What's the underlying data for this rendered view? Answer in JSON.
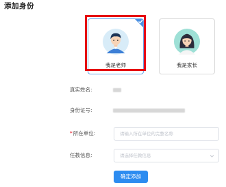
{
  "page": {
    "title": "添加身份"
  },
  "roles": [
    {
      "label": "我是老师",
      "selected": true
    },
    {
      "label": "我是家长",
      "selected": false
    }
  ],
  "form": {
    "real_name": {
      "label": "真实姓名:"
    },
    "id_number": {
      "label": "身份证号:"
    },
    "unit": {
      "label": "所在单位:",
      "required": "*",
      "placeholder": "请输入所在单位的完整名称"
    },
    "subject": {
      "label": "任教信息:",
      "placeholder": "请选择任教信息"
    }
  },
  "actions": {
    "submit_label": "确定添加"
  },
  "colors": {
    "primary": "#2d8cf0",
    "highlight": "#e60012",
    "selected_border": "#6aa6e8"
  }
}
